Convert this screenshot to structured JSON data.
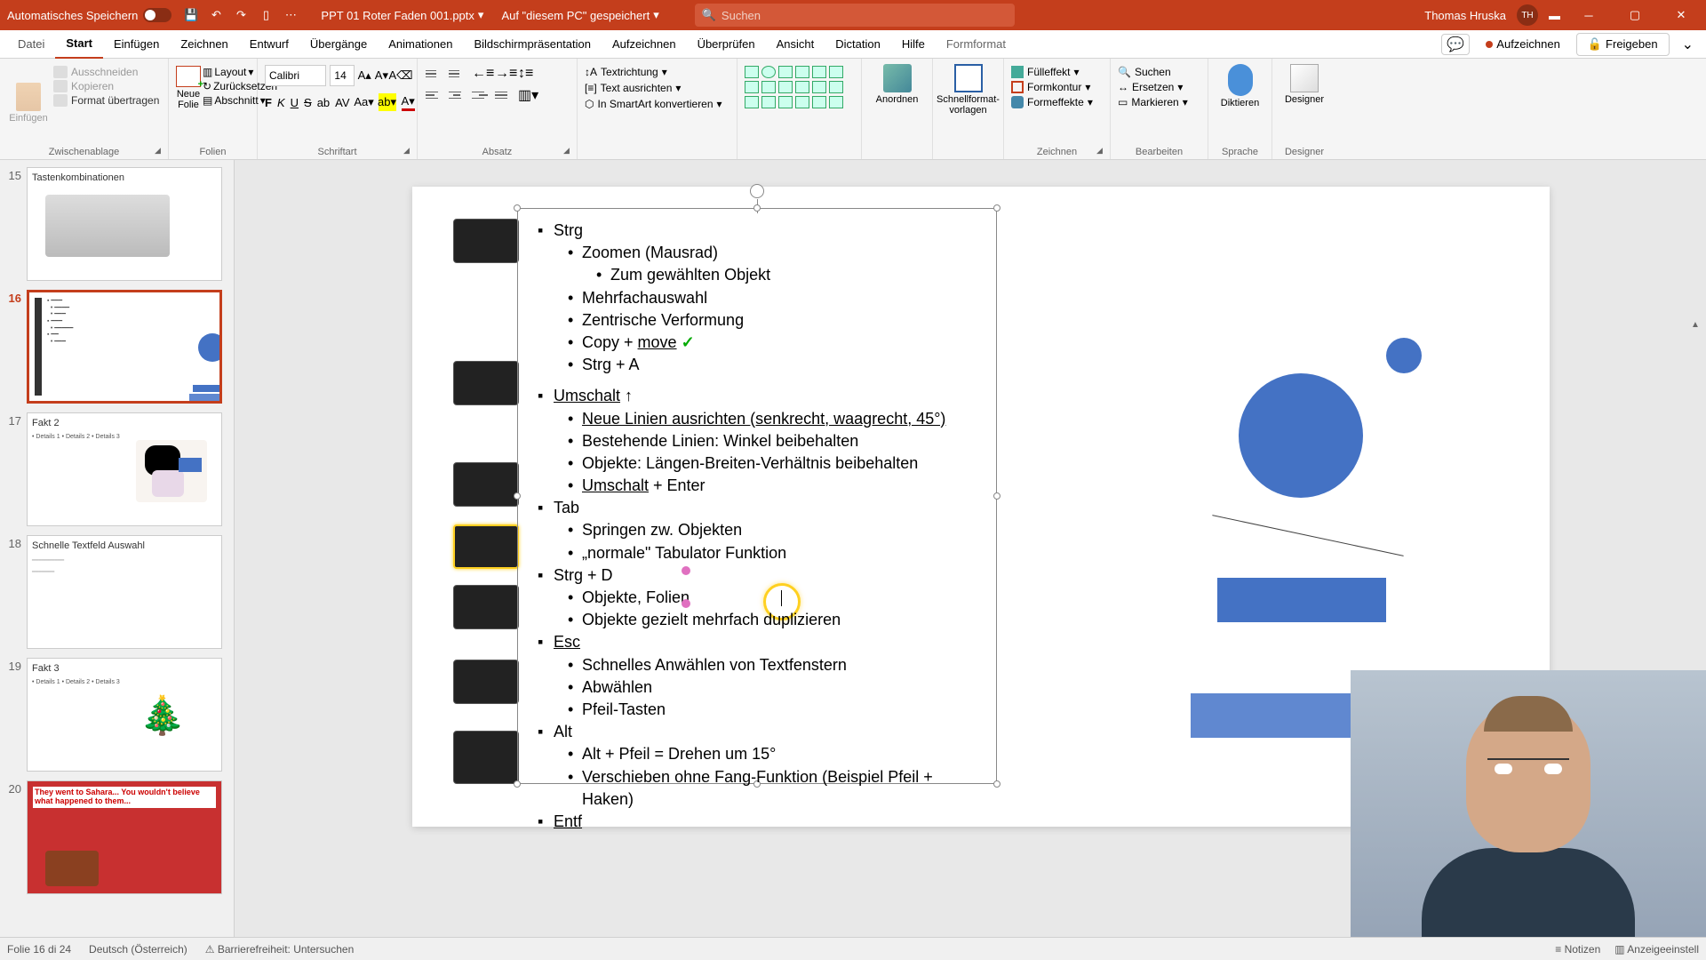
{
  "titlebar": {
    "autosave": "Automatisches Speichern",
    "filename": "PPT 01 Roter Faden 001.pptx",
    "saved": "Auf \"diesem PC\" gespeichert",
    "search_placeholder": "Suchen",
    "user": "Thomas Hruska",
    "user_initials": "TH"
  },
  "tabs": {
    "file": "Datei",
    "start": "Start",
    "insert": "Einfügen",
    "draw": "Zeichnen",
    "design": "Entwurf",
    "transitions": "Übergänge",
    "animations": "Animationen",
    "slideshow": "Bildschirmpräsentation",
    "record": "Aufzeichnen",
    "review": "Überprüfen",
    "view": "Ansicht",
    "dictation": "Dictation",
    "help": "Hilfe",
    "shapeformat": "Formformat",
    "record_btn": "Aufzeichnen",
    "share": "Freigeben"
  },
  "ribbon": {
    "clipboard": {
      "label": "Zwischenablage",
      "paste": "Einfügen",
      "cut": "Ausschneiden",
      "copy": "Kopieren",
      "painter": "Format übertragen"
    },
    "slides": {
      "label": "Folien",
      "new": "Neue Folie",
      "layout": "Layout",
      "reset": "Zurücksetzen",
      "section": "Abschnitt"
    },
    "font": {
      "label": "Schriftart",
      "name": "Calibri",
      "size": "14"
    },
    "paragraph": {
      "label": "Absatz"
    },
    "textr": {
      "label": "",
      "direction": "Textrichtung",
      "align": "Text ausrichten",
      "smartart": "In SmartArt konvertieren"
    },
    "drawing": {
      "label": "Zeichnen",
      "arrange": "Anordnen",
      "quick": "Schnellformat-vorlagen",
      "fill": "Fülleffekt",
      "outline": "Formkontur",
      "effects": "Formeffekte"
    },
    "edit": {
      "label": "Bearbeiten",
      "find": "Suchen",
      "replace": "Ersetzen",
      "select": "Markieren"
    },
    "voice": {
      "label": "Sprache",
      "dictate": "Diktieren"
    },
    "designer": {
      "label": "Designer",
      "btn": "Designer"
    }
  },
  "thumbs": [
    {
      "num": "15",
      "title": "Tastenkombinationen"
    },
    {
      "num": "16",
      "title": ""
    },
    {
      "num": "17",
      "title": "Fakt 2",
      "detail": "• Details 1\n• Details 2\n• Details 3"
    },
    {
      "num": "18",
      "title": "Schnelle Textfeld Auswahl"
    },
    {
      "num": "19",
      "title": "Fakt 3",
      "detail": "• Details 1\n• Details 2\n• Details 3"
    },
    {
      "num": "20",
      "title": "",
      "caption": "They went to Sahara...\nYou wouldn't believe what\nhappened to them..."
    }
  ],
  "slide": {
    "strg": "Strg",
    "zoom": "Zoomen (Mausrad)",
    "zoom_obj": "Zum gewählten Objekt",
    "multi": "Mehrfachauswahl",
    "zentr": "Zentrische Verformung",
    "copy": "Copy + ",
    "move": "move",
    "strga": "Strg + A",
    "umschalt": "Umschalt",
    "umschalt_arrow": " ↑",
    "linien_neu": "Neue Linien ausrichten (senkrecht, waagrecht, 45°)",
    "linien_best": "Bestehende Linien: Winkel beibehalten",
    "obj_ratio": "Objekte: Längen-Breiten-Verhältnis beibehalten",
    "umschalt_enter_1": "Umschalt",
    "umschalt_enter_2": " + Enter",
    "tab": "Tab",
    "tab_spring": "Springen zw. Objekten",
    "tab_norm": "„normale\" Tabulator Funktion",
    "strgd": "Strg + D",
    "strgd_obj": "Objekte, Folien",
    "strgd_dup": "Objekte gezielt mehrfach duplizieren",
    "esc": "Esc",
    "esc_text": "Schnelles Anwählen von Textfenstern",
    "esc_abw": "Abwählen",
    "esc_pfeil": "Pfeil-Tasten",
    "alt": "Alt",
    "alt_pfeil": "Alt + Pfeil = Drehen um 15°",
    "alt_versch": "Verschieben ohne Fang-Funktion (Beispiel Pfeil + Haken)",
    "entf": "Entf"
  },
  "status": {
    "slide_count": "Folie 16 di 24",
    "lang": "Deutsch (Österreich)",
    "access": "Barrierefreiheit: Untersuchen",
    "notes": "Notizen",
    "display": "Anzeigeeinstell"
  }
}
